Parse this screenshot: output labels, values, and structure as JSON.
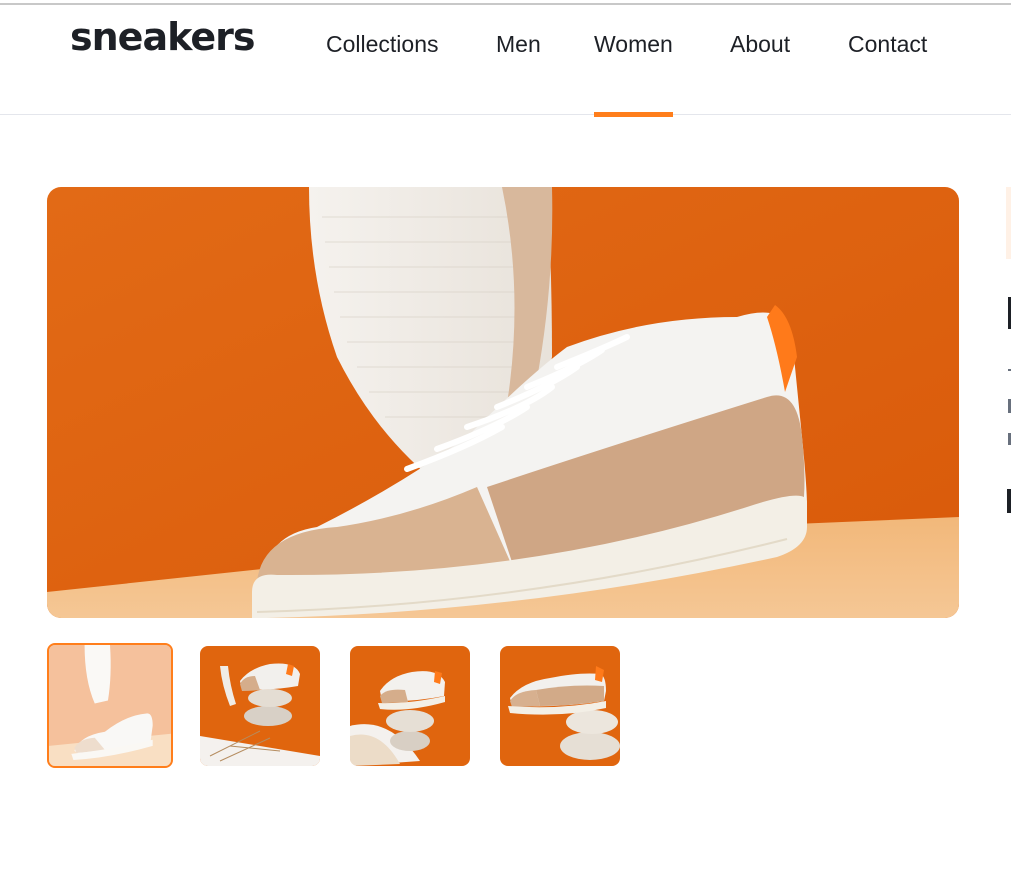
{
  "brand": {
    "logo_text": "sneakers",
    "accent_color": "#ff7e1b",
    "text_color": "#1d2026"
  },
  "nav": {
    "items": [
      {
        "label": "Collections",
        "active": false
      },
      {
        "label": "Men",
        "active": false
      },
      {
        "label": "Women",
        "active": true
      },
      {
        "label": "About",
        "active": false
      },
      {
        "label": "Contact",
        "active": false
      }
    ]
  },
  "gallery": {
    "main_image_icon": "sneaker-photo",
    "selected_thumbnail": 1,
    "thumbnails": [
      {
        "icon": "sneaker-thumbnail-1"
      },
      {
        "icon": "sneaker-thumbnail-2"
      },
      {
        "icon": "sneaker-thumbnail-3"
      },
      {
        "icon": "sneaker-thumbnail-4"
      }
    ]
  }
}
